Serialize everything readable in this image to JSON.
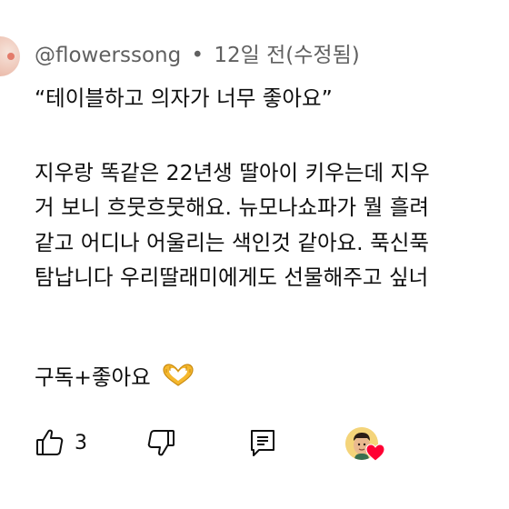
{
  "comment": {
    "author": "@flowerssong",
    "separator": "•",
    "time": "12일 전(수정됨)",
    "lines": [
      "“테이블하고 의자가 너무 좋아요”",
      "",
      "지우랑 똑같은 22년생 딸아이 키우는데 지우",
      "거 보니 흐뭇흐뭇해요. 뉴모나쇼파가 뭘 흘려",
      "같고 어디나 어울리는 색인것 같아요. 푹신푹",
      "탐납니다 우리딸래미에게도 선물해주고 싶너",
      "",
      "구독+좋아요"
    ],
    "emoji": "heart-hands-emoji"
  },
  "actions": {
    "like_count": "3",
    "like_icon": "thumbs-up-icon",
    "dislike_icon": "thumbs-down-icon",
    "reply_icon": "reply-comment-icon",
    "creator_heart": "creator-heart-icon"
  },
  "colors": {
    "text": "#0f0f0f",
    "meta": "#606060",
    "heart": "#ff0033",
    "emoji": "#f5b82e"
  }
}
